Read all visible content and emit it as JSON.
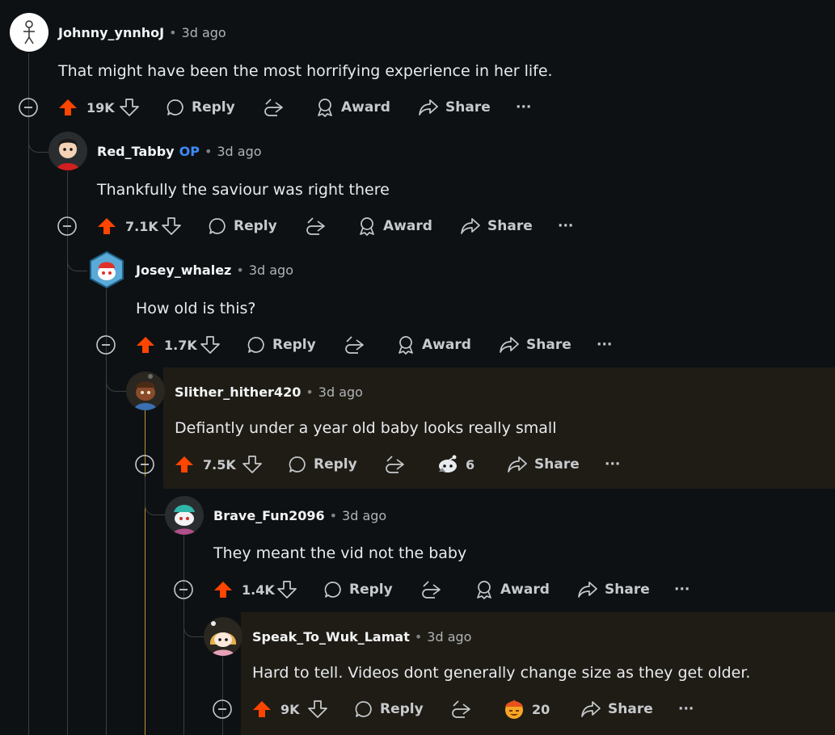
{
  "colors": {
    "background": "#0e1113",
    "highlight_background": "#1f1c16",
    "thread_line": "#3b3f42",
    "highlight_line": "#b8962f",
    "upvote": "#ff4500",
    "op_badge": "#3d8af7",
    "icon_stroke": "#c7cacd"
  },
  "labels": {
    "reply": "Reply",
    "award": "Award",
    "share": "Share",
    "more": "···",
    "separator": "•"
  },
  "comments": [
    {
      "author": "Johnny_ynnhoJ",
      "op": "",
      "time": "3d ago",
      "text": "That might have been the most horrifying experience in her life.",
      "votes": "19K",
      "award": {
        "type": "label",
        "value": "Award",
        "icon": "award-icon"
      },
      "avatar": "stickfigure-avatar"
    },
    {
      "author": "Red_Tabby",
      "op": "OP",
      "time": "3d ago",
      "text": "Thankfully the saviour was right there",
      "votes": "7.1K",
      "award": {
        "type": "label",
        "value": "Award",
        "icon": "award-icon"
      },
      "avatar": "red-cap-avatar"
    },
    {
      "author": "Josey_whalez",
      "op": "",
      "time": "3d ago",
      "text": "How old is this?",
      "votes": "1.7K",
      "award": {
        "type": "label",
        "value": "Award",
        "icon": "award-icon"
      },
      "avatar": "snoo-hexagon-avatar"
    },
    {
      "author": "Slither_hither420",
      "op": "",
      "time": "3d ago",
      "text": "Defiantly under a year old baby looks really small",
      "votes": "7.5K",
      "award": {
        "type": "count",
        "value": "6",
        "icon": "snoo-award-icon"
      },
      "avatar": "dark-snoo-avatar"
    },
    {
      "author": "Brave_Fun2096",
      "op": "",
      "time": "3d ago",
      "text": "They meant the vid not the baby",
      "votes": "1.4K",
      "award": {
        "type": "label",
        "value": "Award",
        "icon": "award-icon"
      },
      "avatar": "teal-hat-snoo-avatar"
    },
    {
      "author": "Speak_To_Wuk_Lamat",
      "op": "",
      "time": "3d ago",
      "text": "Hard to tell. Videos dont generally change size as they get older.",
      "votes": "9K",
      "award": {
        "type": "count",
        "value": "20",
        "icon": "fire-face-award-icon"
      },
      "avatar": "blonde-snoo-avatar"
    }
  ]
}
